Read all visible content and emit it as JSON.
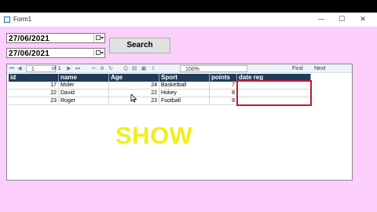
{
  "window": {
    "title": "Form1",
    "minimize_glyph": "—",
    "maximize_glyph": "☐",
    "close_glyph": "✕"
  },
  "date_from": {
    "value": "27/06/2021"
  },
  "date_to": {
    "value": "27/06/2021"
  },
  "search_button": {
    "label": "Search"
  },
  "report_toolbar": {
    "page": "1",
    "of_label": "of 1",
    "zoom": "100%",
    "find_label": "Find",
    "next_label": "Next"
  },
  "table": {
    "columns": [
      "id",
      "name",
      "Age",
      "Sport",
      "points",
      "date reg"
    ],
    "rows": [
      {
        "id": "17",
        "name": "Moler",
        "age": "24",
        "sport": "Basketball",
        "points": "7",
        "date_reg": ""
      },
      {
        "id": "22",
        "name": "David",
        "age": "22",
        "sport": "Hokey",
        "points": "8",
        "date_reg": ""
      },
      {
        "id": "23",
        "name": "Roger",
        "age": "23",
        "sport": "Football",
        "points": "9",
        "date_reg": ""
      }
    ]
  },
  "overlay_text": "SHOW",
  "colors": {
    "background": "#fccffc",
    "header": "#1f3b5a",
    "highlight_border": "#c31a2b",
    "overlay_text": "#f2ee1c"
  }
}
